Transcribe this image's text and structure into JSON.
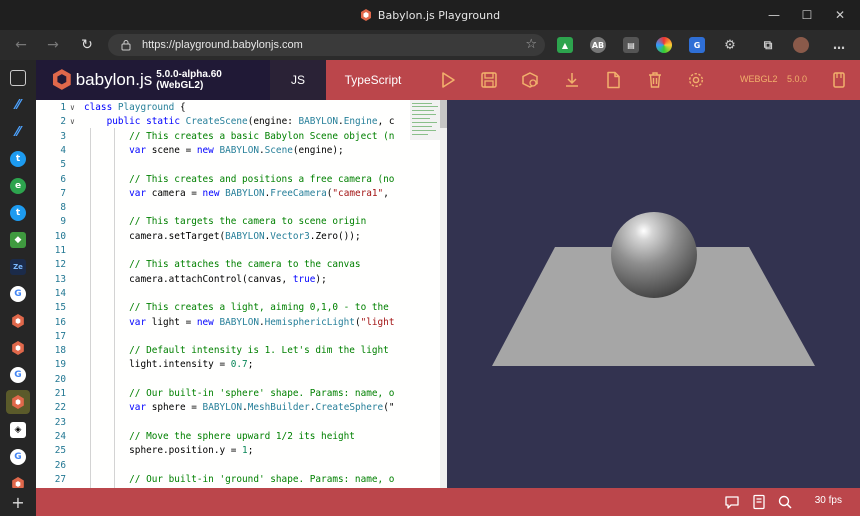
{
  "window": {
    "title": "Babylon.js Playground",
    "controls": [
      "minimize",
      "maximize",
      "close"
    ]
  },
  "browser": {
    "url": "https://playground.babylonjs.com",
    "nav": [
      "back",
      "forward",
      "refresh"
    ],
    "extensions": [
      "extension-green",
      "adblock",
      "extension-grey",
      "extension-color",
      "translate",
      "extensions-puzzle",
      "collections",
      "profile"
    ]
  },
  "sidebar": {
    "items": [
      {
        "name": "tabs-icon"
      },
      {
        "name": "site-icon-1"
      },
      {
        "name": "site-icon-2"
      },
      {
        "name": "twitter-icon"
      },
      {
        "name": "green-icon"
      },
      {
        "name": "twitter-icon-2"
      },
      {
        "name": "cube-icon"
      },
      {
        "name": "ze-icon"
      },
      {
        "name": "google-icon"
      },
      {
        "name": "babylon-icon"
      },
      {
        "name": "babylon-icon-2"
      },
      {
        "name": "google-icon-2"
      },
      {
        "name": "babylon-icon-active"
      },
      {
        "name": "codepen-icon"
      },
      {
        "name": "google-icon-3"
      },
      {
        "name": "babylon-icon-3"
      }
    ],
    "add_label": "+"
  },
  "header": {
    "brand": "babylon.js",
    "version": "5.0.0-alpha.60 (WebGL2)",
    "tab_js": "JS",
    "tab_ts": "TypeScript",
    "webgl_label": "WEBGL2",
    "engine_version": "5.0.0",
    "accent": "#bb464b",
    "dark": "#201936"
  },
  "editor": {
    "lines": [
      {
        "n": "1",
        "fold": true
      },
      {
        "n": "2",
        "fold": true
      },
      {
        "n": "3"
      },
      {
        "n": "4"
      },
      {
        "n": "5"
      },
      {
        "n": "6"
      },
      {
        "n": "7"
      },
      {
        "n": "8"
      },
      {
        "n": "9"
      },
      {
        "n": "10"
      },
      {
        "n": "11"
      },
      {
        "n": "12"
      },
      {
        "n": "13"
      },
      {
        "n": "14"
      },
      {
        "n": "15"
      },
      {
        "n": "16"
      },
      {
        "n": "17"
      },
      {
        "n": "18"
      },
      {
        "n": "19"
      },
      {
        "n": "20"
      },
      {
        "n": "21"
      },
      {
        "n": "22"
      },
      {
        "n": "23"
      },
      {
        "n": "24"
      },
      {
        "n": "25"
      },
      {
        "n": "26"
      },
      {
        "n": "27"
      }
    ],
    "code": {
      "l1": [
        "class ",
        "Playground",
        " {"
      ],
      "l2": [
        "public ",
        "static ",
        "CreateScene",
        "(engine: ",
        "BABYLON",
        ".",
        "Engine",
        ", c"
      ],
      "l3": "// This creates a basic Babylon Scene object (n",
      "l4": [
        "var ",
        "scene = ",
        "new ",
        "BABYLON",
        ".",
        "Scene",
        "(engine);"
      ],
      "l6": "// This creates and positions a free camera (no",
      "l7": [
        "var ",
        "camera = ",
        "new ",
        "BABYLON",
        ".",
        "FreeCamera",
        "(",
        "\"camera1\"",
        ","
      ],
      "l9": "// This targets the camera to scene origin",
      "l10": [
        "camera.setTarget(",
        "BABYLON",
        ".",
        "Vector3",
        ".Zero());"
      ],
      "l12": "// This attaches the camera to the canvas",
      "l13": [
        "camera.attachControl(canvas, ",
        "true",
        ");"
      ],
      "l15": "// This creates a light, aiming 0,1,0 - to the",
      "l16": [
        "var ",
        "light = ",
        "new ",
        "BABYLON",
        ".",
        "HemisphericLight",
        "(",
        "\"light"
      ],
      "l18": "// Default intensity is 1. Let's dim the light",
      "l19": [
        "light.intensity = ",
        "0.7",
        ";"
      ],
      "l21": "// Our built-in 'sphere' shape. Params: name, o",
      "l22": [
        "var ",
        "sphere = ",
        "BABYLON",
        ".",
        "MeshBuilder",
        ".",
        "CreateSphere",
        "(\""
      ],
      "l24": "// Move the sphere upward 1/2 its height",
      "l25": [
        "sphere.position.y = ",
        "1",
        ";"
      ],
      "l27": "// Our built-in 'ground' shape. Params: name, o"
    }
  },
  "scene": {
    "background": "#333350",
    "ground_color": "#a6a6a6",
    "sphere_color": "#8f8f8f"
  },
  "footer": {
    "fps": "30 fps"
  }
}
